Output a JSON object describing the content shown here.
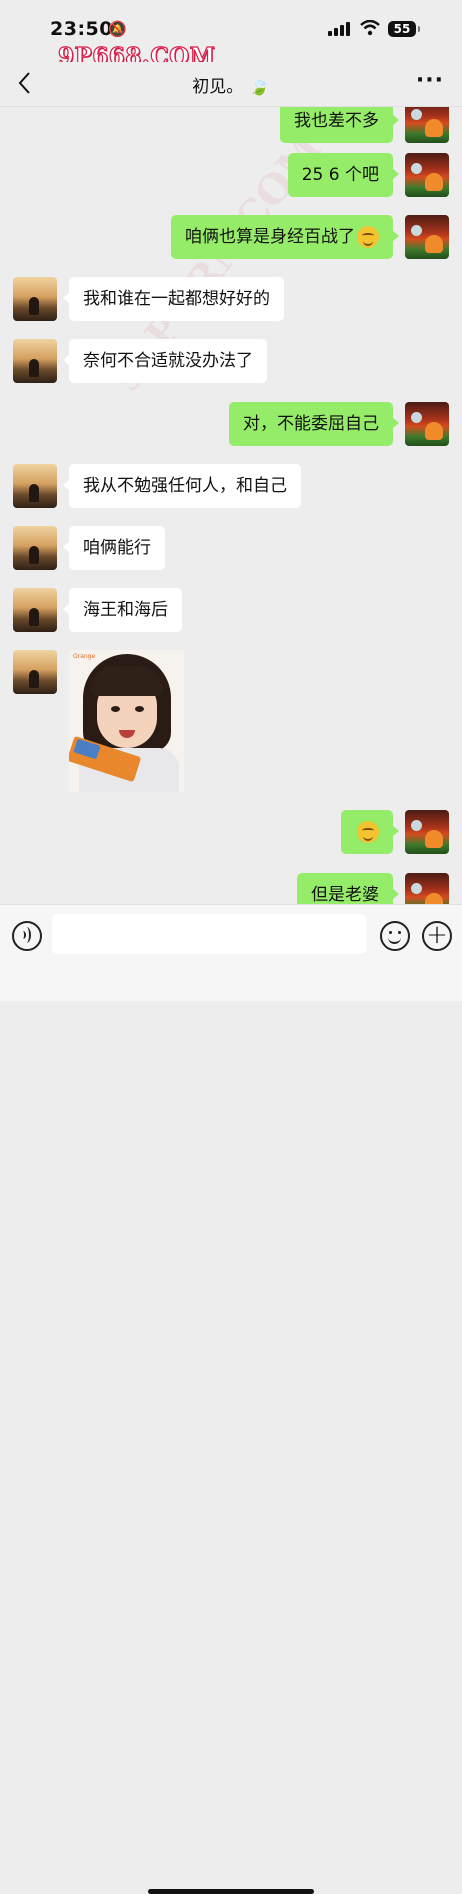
{
  "status_bar": {
    "time": "23:50",
    "battery": "55"
  },
  "watermark_top": "9P668.COM",
  "watermark_diagonal": "91PORN.COM",
  "nav": {
    "title": "初见。",
    "title_emoji": "🍃"
  },
  "messages": [
    {
      "side": "me",
      "text": "我也差不多"
    },
    {
      "side": "me",
      "text": "25 6 个吧"
    },
    {
      "side": "me",
      "text": "咱俩也算是身经百战了",
      "emoji": "smirk-face"
    },
    {
      "side": "you",
      "text": "我和谁在一起都想好好的"
    },
    {
      "side": "you",
      "text": "奈何不合适就没办法了"
    },
    {
      "side": "me",
      "text": "对，不能委屈自己"
    },
    {
      "side": "you",
      "text": "我从不勉强任何人，和自己"
    },
    {
      "side": "you",
      "text": "咱俩能行"
    },
    {
      "side": "you",
      "text": "海王和海后"
    },
    {
      "side": "you",
      "type": "sticker",
      "sticker_label": "Orange"
    },
    {
      "side": "me",
      "type": "emoji",
      "emoji": "smirk-face"
    },
    {
      "side": "me",
      "text": "但是老婆"
    }
  ],
  "input_bar": {
    "placeholder": "",
    "icons": [
      "voice-icon",
      "emoji-icon",
      "plus-icon"
    ]
  }
}
